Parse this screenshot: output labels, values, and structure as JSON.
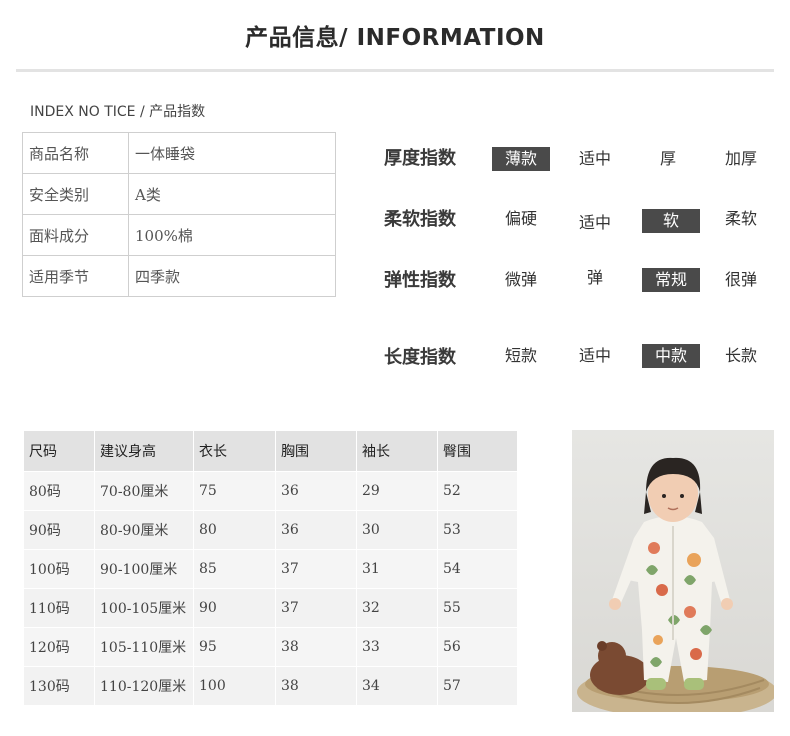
{
  "header": {
    "title": "产品信息/ INFORMATION",
    "subtitle": "INDEX NO TICE / 产品指数"
  },
  "product_info": [
    {
      "label": "商品名称",
      "value": "一体睡袋"
    },
    {
      "label": "安全类别",
      "value": "A类"
    },
    {
      "label": "面料成分",
      "value": "100%棉"
    },
    {
      "label": "适用季节",
      "value": "四季款"
    }
  ],
  "indices": [
    {
      "label": "厚度指数",
      "options": [
        "薄款",
        "适中",
        "厚",
        "加厚"
      ],
      "selected": 0
    },
    {
      "label": "柔软指数",
      "options": [
        "偏硬",
        "适中",
        "软",
        "柔软"
      ],
      "selected": 2
    },
    {
      "label": "弹性指数",
      "options": [
        "微弹",
        "弹",
        "常规",
        "很弹"
      ],
      "selected": 2
    },
    {
      "label": "长度指数",
      "options": [
        "短款",
        "适中",
        "中款",
        "长款"
      ],
      "selected": 2
    }
  ],
  "size_table": {
    "headers": [
      "尺码",
      "建议身高",
      "衣长",
      "胸围",
      "袖长",
      "臀围"
    ],
    "rows": [
      [
        "80码",
        "70-80厘米",
        "75",
        "36",
        "29",
        "52"
      ],
      [
        "90码",
        "80-90厘米",
        "80",
        "36",
        "30",
        "53"
      ],
      [
        "100码",
        "90-100厘米",
        "85",
        "37",
        "31",
        "54"
      ],
      [
        "110码",
        "100-105厘米",
        "90",
        "37",
        "32",
        "55"
      ],
      [
        "120码",
        "105-110厘米",
        "95",
        "38",
        "33",
        "56"
      ],
      [
        "130码",
        "110-120厘米",
        "100",
        "38",
        "34",
        "57"
      ]
    ]
  },
  "colors": {
    "selected_bg": "#4a4a4a",
    "header_bg": "#e2e2e2",
    "row_bg": "#f5f5f5"
  },
  "photo": {
    "icon": "child-sleep-sack-photo"
  }
}
